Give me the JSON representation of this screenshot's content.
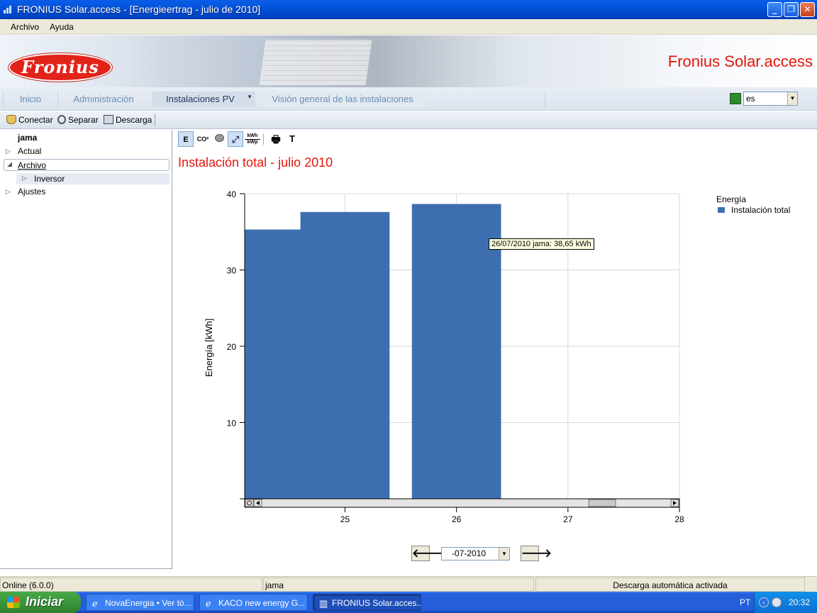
{
  "window": {
    "title": "FRONIUS Solar.access - [Energieertrag - julio de 2010]"
  },
  "menu": {
    "archivo": "Archivo",
    "ayuda": "Ayuda"
  },
  "banner": {
    "logo": "Fronius",
    "brand": "Fronius Solar.access"
  },
  "nav": {
    "tabs": [
      "Inicio",
      "Administración",
      "Instalaciones PV",
      "Visión general de las instalaciones"
    ],
    "language": "es"
  },
  "toolbar": {
    "connect": "Conectar",
    "disconnect": "Separar",
    "download": "Descarga"
  },
  "tree": {
    "root": "jama",
    "items": [
      "Actual",
      "Archivo",
      "Inversor",
      "Ajustes"
    ]
  },
  "chart_tools": {
    "energy": "E",
    "co2": "CO²",
    "kwh_top": "kWh",
    "kwh_bottom": "kWp",
    "text": "T"
  },
  "chart_data": {
    "type": "bar",
    "title": "Instalación total - julio 2010",
    "ylabel": "Energía [kWh]",
    "xlabel": "",
    "ylim": [
      0,
      40
    ],
    "yticks": [
      10,
      20,
      30,
      40
    ],
    "xticks": [
      "25",
      "26",
      "27",
      "28"
    ],
    "x_range": [
      24.1,
      28
    ],
    "bars": [
      {
        "x": 24.25,
        "value": 35.3
      },
      {
        "x": 25.0,
        "value": 37.6
      },
      {
        "x": 26.0,
        "value": 38.65
      }
    ],
    "legend_title": "Energía",
    "series": [
      {
        "name": "Instalación total",
        "color": "#3d6fb0"
      }
    ],
    "grid": true,
    "legend": "top-right",
    "tooltip": "26/07/2010 jama: 38,65 kWh"
  },
  "period_select": {
    "value": "-07-2010"
  },
  "status": {
    "online": "Online (6.0.0)",
    "user": "jama",
    "message": "Descarga automática activada"
  },
  "taskbar": {
    "start": "Iniciar",
    "tasks": [
      "NovaEnergia • Ver tó...",
      "KACO new energy G...",
      "FRONIUS Solar.acces..."
    ],
    "lang": "PT",
    "clock": "20:32"
  }
}
